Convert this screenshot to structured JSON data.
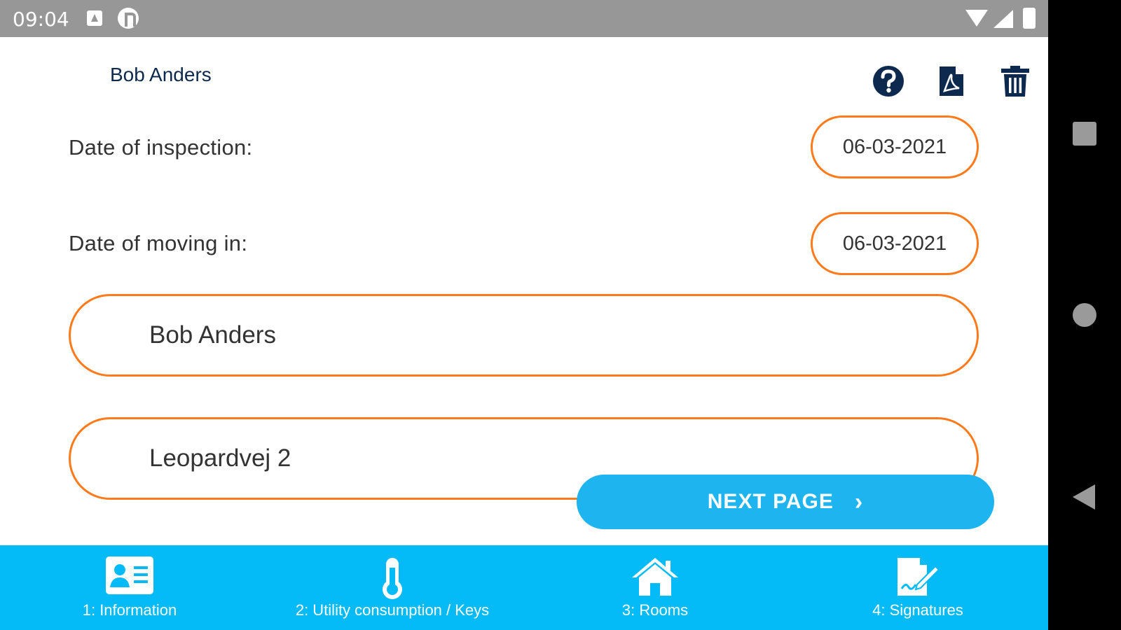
{
  "status_bar": {
    "time": "09:04"
  },
  "header": {
    "title": "Bob Anders"
  },
  "form": {
    "inspection_label": "Date of inspection:",
    "inspection_value": "06-03-2021",
    "moving_label": "Date of moving in:",
    "moving_value": "06-03-2021",
    "name_value": "Bob Anders",
    "address_value": "Leopardvej 2"
  },
  "next_button": {
    "label": "NEXT PAGE",
    "chevron": "›"
  },
  "tabs": [
    {
      "label": "1: Information",
      "icon": "id-card-icon"
    },
    {
      "label": "2: Utility consumption / Keys",
      "icon": "thermometer-icon"
    },
    {
      "label": "3: Rooms",
      "icon": "house-icon"
    },
    {
      "label": "4: Signatures",
      "icon": "signature-icon"
    }
  ],
  "colors": {
    "accent": "#ff7a1a",
    "primary": "#04baf7",
    "button": "#1eb4ef",
    "dark": "#0d2a4e"
  }
}
